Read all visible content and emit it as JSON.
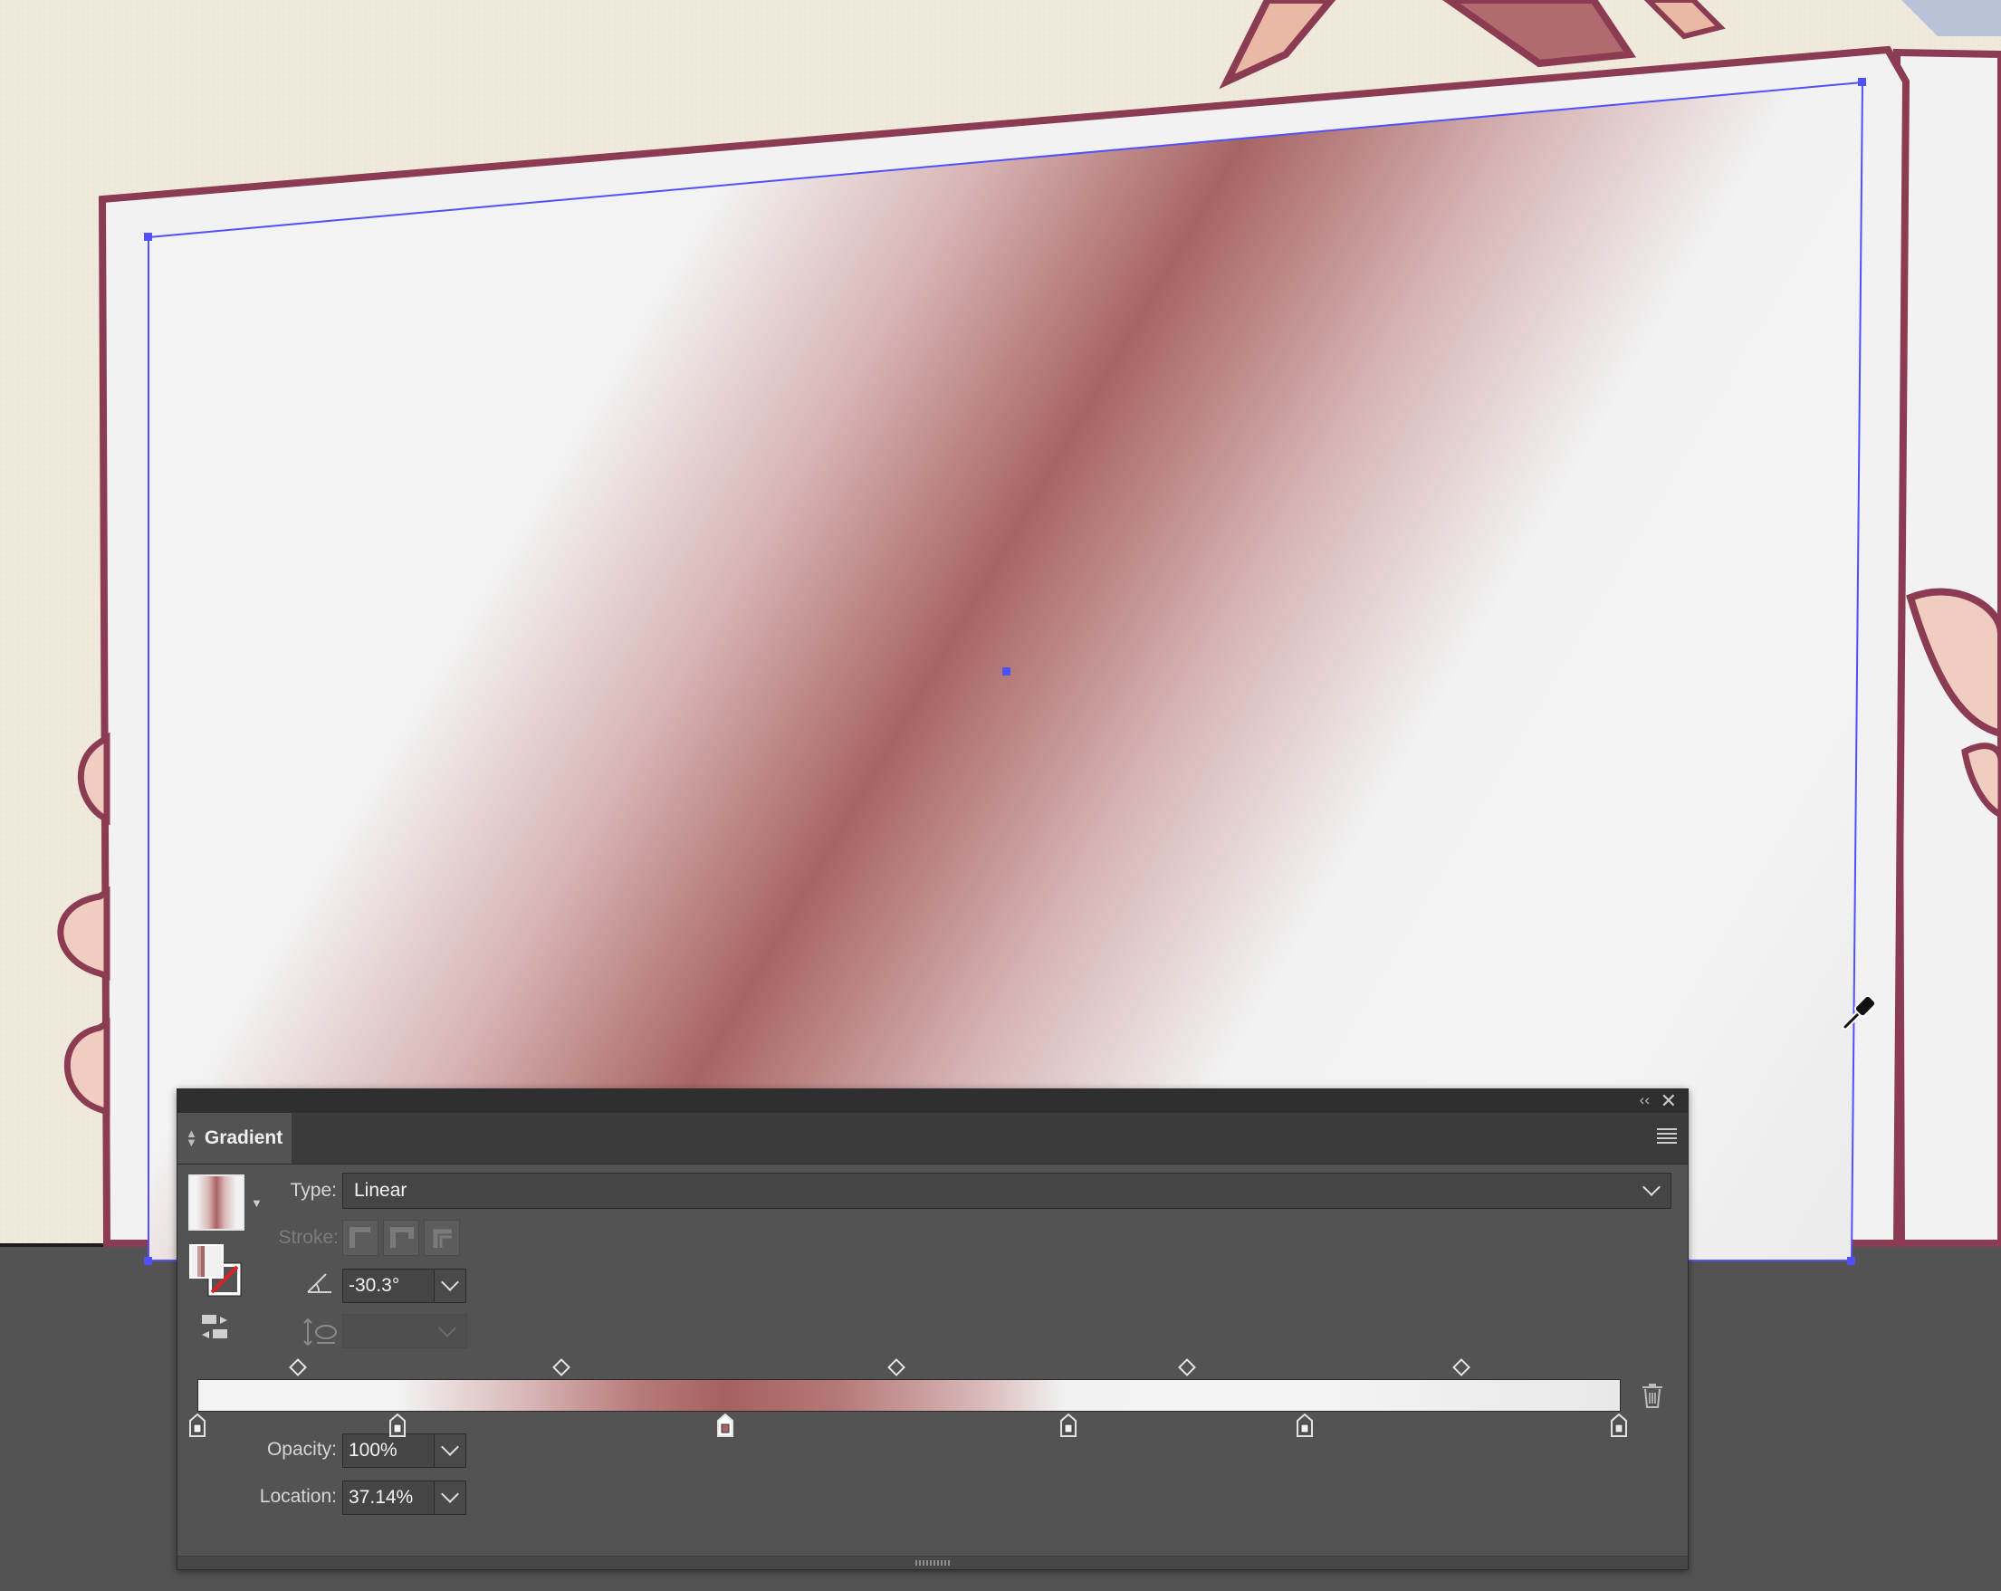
{
  "colors": {
    "selection": "#5050ff",
    "panel_bg": "#535353",
    "gradient_main": "#a86464",
    "gradient_light": "#f3f3f3",
    "outline": "#8c3c52"
  },
  "panel": {
    "tab_title": "Gradient",
    "collapse_icon": "double-chevron-left-icon",
    "close_icon": "close-icon",
    "menu_icon": "hamburger-menu-icon",
    "type_label": "Type:",
    "type_value": "Linear",
    "stroke_label": "Stroke:",
    "angle_value": "-30.3°",
    "aspect_value": "",
    "opacity_label": "Opacity:",
    "opacity_value": "100%",
    "location_label": "Location:",
    "location_value": "37.14%"
  },
  "gradient_stops": [
    {
      "location": 0,
      "color": "#f3f3f3",
      "selected": false
    },
    {
      "location": 14.1,
      "color": "#f3f3f3",
      "selected": false
    },
    {
      "location": 37.14,
      "color": "#a86464",
      "selected": true
    },
    {
      "location": 61.3,
      "color": "#f2f2f2",
      "selected": false
    },
    {
      "location": 77.9,
      "color": "#f4f4f4",
      "selected": false
    },
    {
      "location": 100,
      "color": "#e8e8e8",
      "selected": false
    }
  ],
  "midpoints": [
    7.1,
    25.6,
    49.2,
    69.6,
    88.9
  ]
}
